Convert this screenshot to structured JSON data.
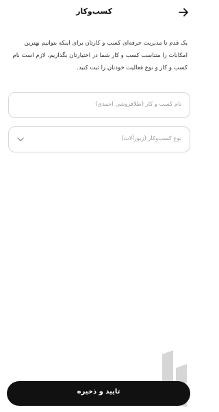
{
  "header": {
    "title": "کسب‌وکار",
    "back_icon": "arrow-right-icon"
  },
  "intro": {
    "text": "یک قدم تا مدیریت حرفه‌ای کسب و کارتان برای اینکه بتوانیم بهترین امکانات را متناسب کسب و کار شما در اختیارتان بگذاریم، لازم است نام کسب و کار و نوع فعالیت خودتان را ثبت کنید."
  },
  "form": {
    "business_name": {
      "placeholder": "نام کسب و کار (طلافروشی احمدی)"
    },
    "business_type": {
      "placeholder": "نوع کسب‌وکار (زیورآلات)",
      "dropdown_icon": "chevron-down-icon"
    }
  },
  "footer": {
    "submit_label": "تایید و ذخیره"
  },
  "colors": {
    "background": "#ffffff",
    "button_bg": "#111111",
    "button_text": "#ffffff",
    "border": "#d7d7d7",
    "placeholder": "#9a9a9a"
  }
}
